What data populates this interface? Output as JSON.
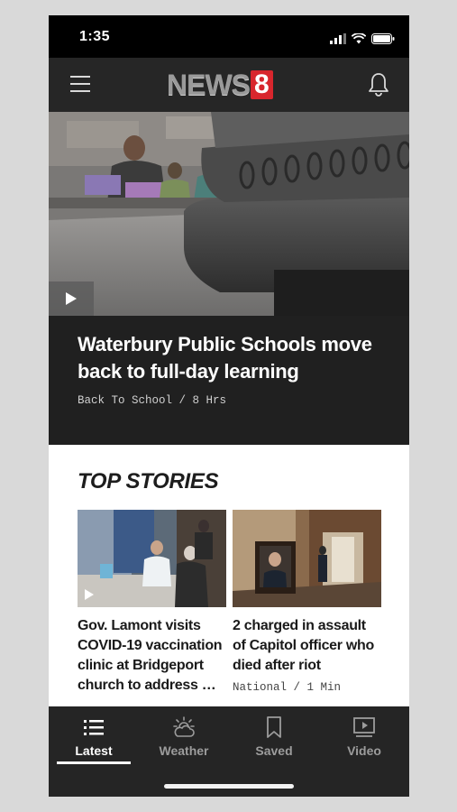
{
  "status_bar": {
    "time": "1:35"
  },
  "header": {
    "logo_text": "NEWS",
    "logo_number": "8"
  },
  "hero": {
    "title": "Waterbury Public Schools move back to full-day learning",
    "meta": "Back To School / 8 Hrs"
  },
  "top_stories": {
    "heading": "TOP STORIES",
    "stories": [
      {
        "title": "Gov. Lamont visits COVID-19 vaccination clinic at Bridgeport church to address …",
        "meta": ""
      },
      {
        "title": "2 charged in assault of Capitol officer who died after riot",
        "meta": "National / 1 Min"
      }
    ]
  },
  "tabs": [
    {
      "label": "Latest",
      "icon": "list-icon",
      "active": true
    },
    {
      "label": "Weather",
      "icon": "weather-icon",
      "active": false
    },
    {
      "label": "Saved",
      "icon": "bookmark-icon",
      "active": false
    },
    {
      "label": "Video",
      "icon": "video-icon",
      "active": false
    }
  ],
  "colors": {
    "logo_red": "#d8262d",
    "dark_bg": "#202020",
    "header_bg": "#262626"
  }
}
